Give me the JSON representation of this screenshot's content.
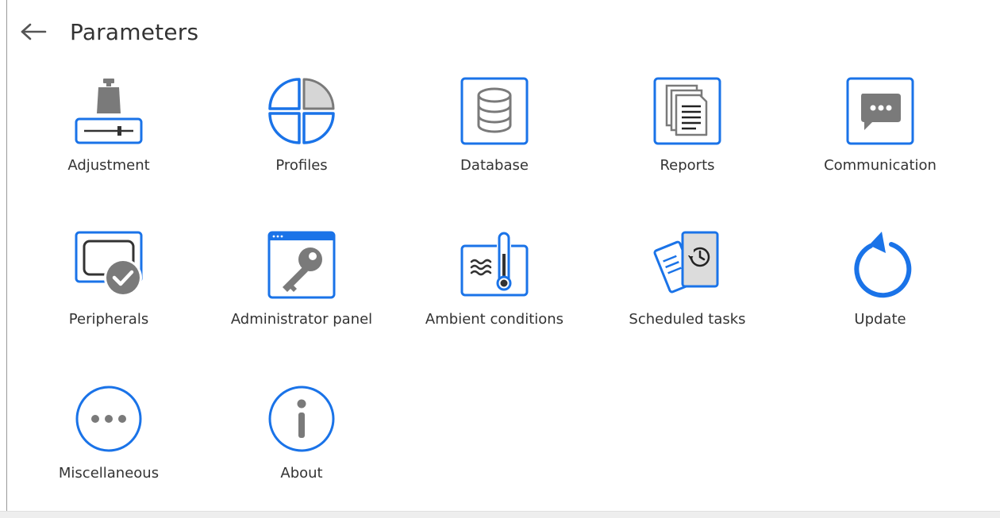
{
  "header": {
    "title": "Parameters",
    "back_icon": "arrow-left-icon"
  },
  "colors": {
    "accent": "#1a73e8",
    "icon_gray": "#7a7a7a",
    "text": "#333333"
  },
  "tiles": [
    {
      "label": "Adjustment",
      "icon": "weight-adjustment-icon"
    },
    {
      "label": "Profiles",
      "icon": "pie-profiles-icon"
    },
    {
      "label": "Database",
      "icon": "database-icon"
    },
    {
      "label": "Reports",
      "icon": "reports-icon"
    },
    {
      "label": "Communication",
      "icon": "chat-bubble-icon"
    },
    {
      "label": "Peripherals",
      "icon": "tablet-check-icon"
    },
    {
      "label": "Administrator panel",
      "icon": "key-window-icon"
    },
    {
      "label": "Ambient conditions",
      "icon": "thermometer-icon"
    },
    {
      "label": "Scheduled tasks",
      "icon": "scheduled-tasks-icon"
    },
    {
      "label": "Update",
      "icon": "refresh-icon"
    },
    {
      "label": "Miscellaneous",
      "icon": "more-dots-icon"
    },
    {
      "label": "About",
      "icon": "info-icon"
    }
  ]
}
